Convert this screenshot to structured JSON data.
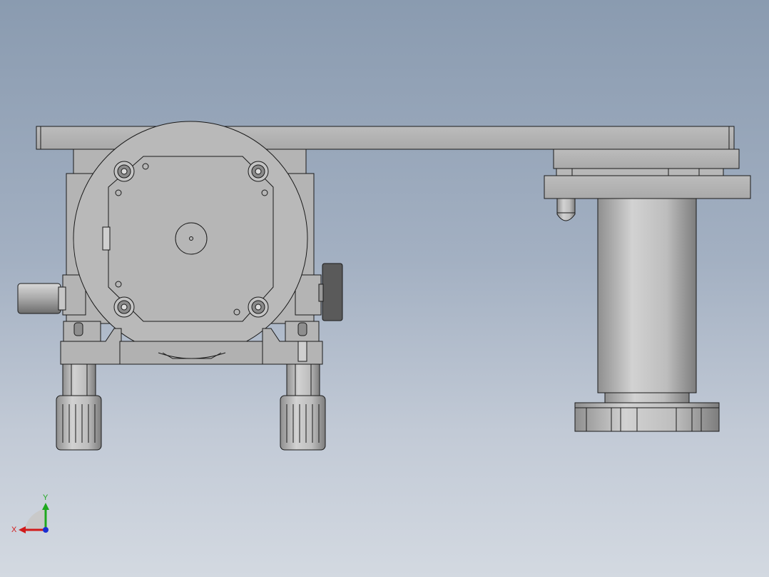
{
  "triad": {
    "x_label": "X",
    "y_label": "Y"
  },
  "colors": {
    "background_top": "#8a9bb0",
    "background_bottom": "#d3d9e1",
    "part_fill": "#b4b4b4",
    "part_edge": "#1a1a1a",
    "axis_x": "#d11b1b",
    "axis_y": "#1ea81e",
    "axis_z": "#1b2fd1"
  }
}
